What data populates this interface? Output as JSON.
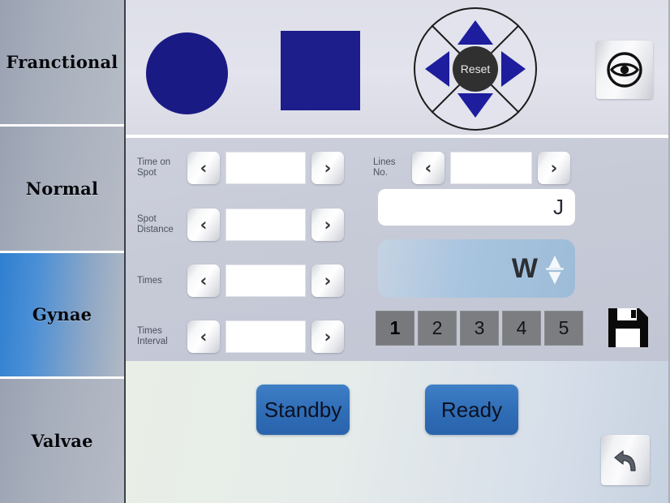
{
  "sidebar": {
    "items": [
      {
        "label": "Franctional",
        "selected": false
      },
      {
        "label": "Normal",
        "selected": false
      },
      {
        "label": "Gynae",
        "selected": true
      },
      {
        "label": "Valvae",
        "selected": false
      }
    ]
  },
  "header": {
    "shape_circle": {
      "name": "circle-shape",
      "color": "#1a1a85"
    },
    "shape_square": {
      "name": "square-shape",
      "color": "#1d1d8c"
    },
    "dpad": {
      "reset_label": "Reset",
      "up": "▲",
      "down": "▼",
      "left": "◀",
      "right": "▶"
    },
    "eye_button": {
      "icon": "eye-icon"
    }
  },
  "form": {
    "left_rows": [
      {
        "label": "Time on\nSpot",
        "label_line1": "Time on",
        "label_line2": "Spot",
        "value": "",
        "prev": "‹",
        "next": "›"
      },
      {
        "label": "Spot\nDistance",
        "label_line1": "Spot",
        "label_line2": "Distance",
        "value": "",
        "prev": "‹",
        "next": "›"
      },
      {
        "label": "Times",
        "label_line1": "Times",
        "label_line2": "",
        "value": "",
        "prev": "‹",
        "next": "›"
      },
      {
        "label": "Times\nInterval",
        "label_line1": "Times",
        "label_line2": "Interval",
        "value": "",
        "prev": "‹",
        "next": "›"
      }
    ],
    "lines_no": {
      "label_line1": "Lines",
      "label_line2": "No.",
      "value": "",
      "prev": "‹",
      "next": "›"
    },
    "energy_field": {
      "value": "",
      "unit": "J"
    },
    "power_panel": {
      "value": "",
      "unit": "W",
      "up": "⌃",
      "down": "⌄"
    },
    "presets": [
      {
        "label": "1",
        "active": true
      },
      {
        "label": "2",
        "active": false
      },
      {
        "label": "3",
        "active": false
      },
      {
        "label": "4",
        "active": false
      },
      {
        "label": "5",
        "active": false
      }
    ],
    "save_button": {
      "icon": "floppy-save-icon"
    }
  },
  "bottom": {
    "standby_label": "Standby",
    "ready_label": "Ready",
    "back_button": {
      "icon": "back-arrow-icon"
    }
  },
  "colors": {
    "accent_blue": "#2f6db6",
    "shape_navy": "#1d1d8c",
    "selected_tab": "#2f7fd0",
    "preset_gray": "#7b7d80"
  }
}
